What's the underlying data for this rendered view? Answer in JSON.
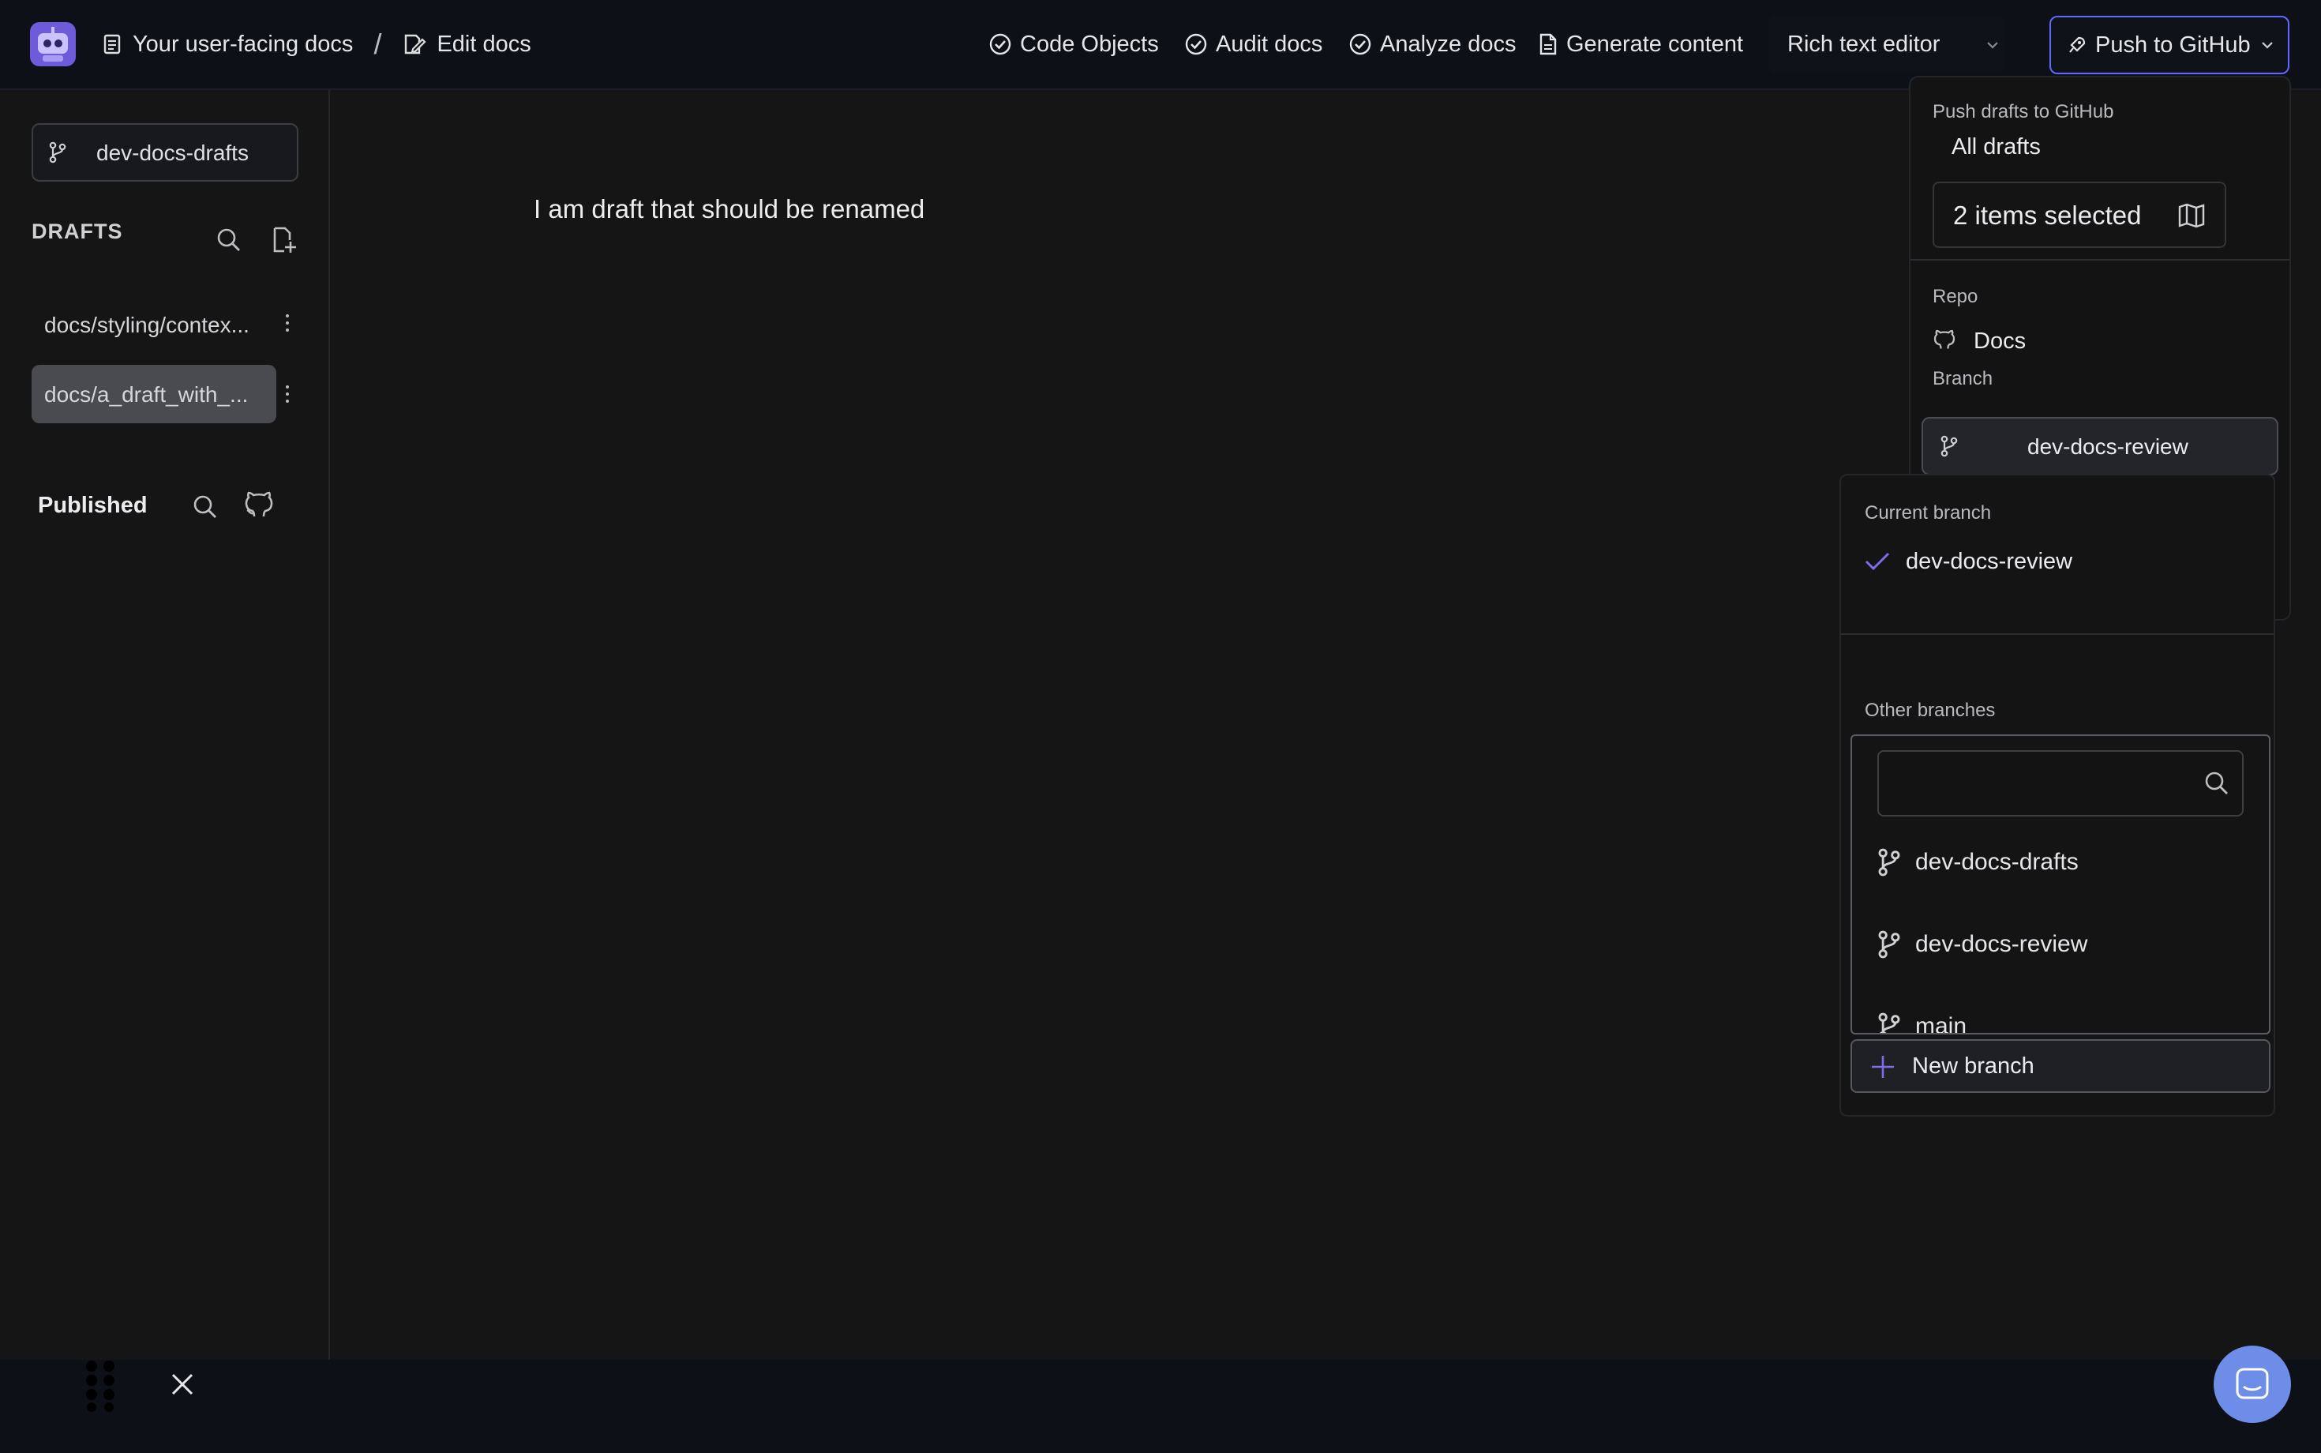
{
  "topbar": {
    "project": "Your user-facing docs",
    "separator": "/",
    "page": "Edit docs",
    "nav": [
      "Code Objects",
      "Audit docs",
      "Analyze docs",
      "Generate content"
    ],
    "editor_mode": "Rich text editor",
    "push_button": "Push to GitHub"
  },
  "sidebar": {
    "branch": "dev-docs-drafts",
    "drafts_heading": "DRAFTS",
    "drafts": [
      "docs/styling/contex...",
      "docs/a_draft_with_..."
    ],
    "published_heading": "Published"
  },
  "editor": {
    "text": "I am draft that should be renamed"
  },
  "push_panel": {
    "title": "Push drafts to GitHub",
    "all_drafts": "All drafts",
    "selection": "2 items selected",
    "repo_label": "Repo",
    "repo_name": "Docs",
    "branch_label": "Branch",
    "branch_value": "dev-docs-review"
  },
  "branch_dropdown": {
    "current_label": "Current branch",
    "current_branch": "dev-docs-review",
    "other_label": "Other branches",
    "search_value": "",
    "branches": [
      "dev-docs-drafts",
      "dev-docs-review",
      "main"
    ],
    "new_branch": "New branch"
  },
  "colors": {
    "accent": "#6d5bd9",
    "check": "#7b6cf0",
    "chat": "#6d8de8"
  }
}
